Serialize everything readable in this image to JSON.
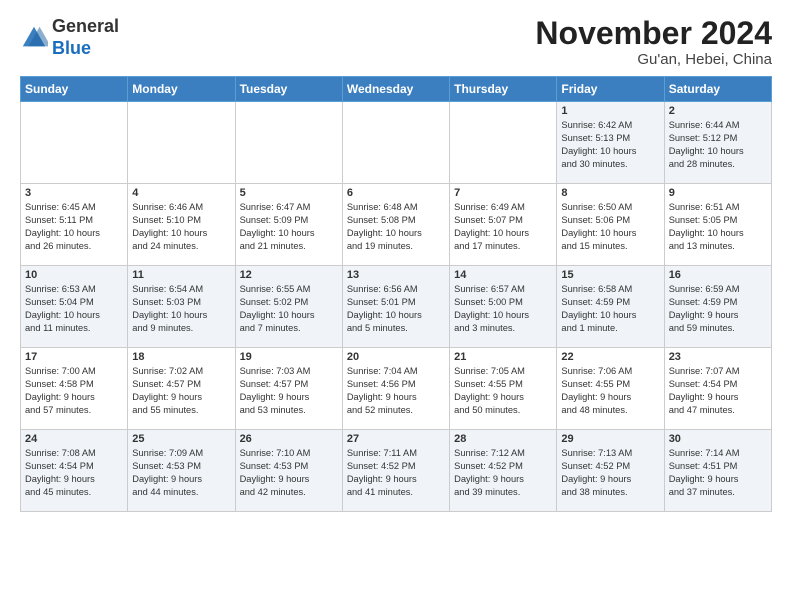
{
  "header": {
    "logo_general": "General",
    "logo_blue": "Blue",
    "month_title": "November 2024",
    "location": "Gu'an, Hebei, China"
  },
  "calendar": {
    "days_of_week": [
      "Sunday",
      "Monday",
      "Tuesday",
      "Wednesday",
      "Thursday",
      "Friday",
      "Saturday"
    ],
    "weeks": [
      {
        "row_class": "alt-row",
        "days": [
          {
            "num": "",
            "info": ""
          },
          {
            "num": "",
            "info": ""
          },
          {
            "num": "",
            "info": ""
          },
          {
            "num": "",
            "info": ""
          },
          {
            "num": "",
            "info": ""
          },
          {
            "num": "1",
            "info": "Sunrise: 6:42 AM\nSunset: 5:13 PM\nDaylight: 10 hours\nand 30 minutes."
          },
          {
            "num": "2",
            "info": "Sunrise: 6:44 AM\nSunset: 5:12 PM\nDaylight: 10 hours\nand 28 minutes."
          }
        ]
      },
      {
        "row_class": "white-row",
        "days": [
          {
            "num": "3",
            "info": "Sunrise: 6:45 AM\nSunset: 5:11 PM\nDaylight: 10 hours\nand 26 minutes."
          },
          {
            "num": "4",
            "info": "Sunrise: 6:46 AM\nSunset: 5:10 PM\nDaylight: 10 hours\nand 24 minutes."
          },
          {
            "num": "5",
            "info": "Sunrise: 6:47 AM\nSunset: 5:09 PM\nDaylight: 10 hours\nand 21 minutes."
          },
          {
            "num": "6",
            "info": "Sunrise: 6:48 AM\nSunset: 5:08 PM\nDaylight: 10 hours\nand 19 minutes."
          },
          {
            "num": "7",
            "info": "Sunrise: 6:49 AM\nSunset: 5:07 PM\nDaylight: 10 hours\nand 17 minutes."
          },
          {
            "num": "8",
            "info": "Sunrise: 6:50 AM\nSunset: 5:06 PM\nDaylight: 10 hours\nand 15 minutes."
          },
          {
            "num": "9",
            "info": "Sunrise: 6:51 AM\nSunset: 5:05 PM\nDaylight: 10 hours\nand 13 minutes."
          }
        ]
      },
      {
        "row_class": "alt-row",
        "days": [
          {
            "num": "10",
            "info": "Sunrise: 6:53 AM\nSunset: 5:04 PM\nDaylight: 10 hours\nand 11 minutes."
          },
          {
            "num": "11",
            "info": "Sunrise: 6:54 AM\nSunset: 5:03 PM\nDaylight: 10 hours\nand 9 minutes."
          },
          {
            "num": "12",
            "info": "Sunrise: 6:55 AM\nSunset: 5:02 PM\nDaylight: 10 hours\nand 7 minutes."
          },
          {
            "num": "13",
            "info": "Sunrise: 6:56 AM\nSunset: 5:01 PM\nDaylight: 10 hours\nand 5 minutes."
          },
          {
            "num": "14",
            "info": "Sunrise: 6:57 AM\nSunset: 5:00 PM\nDaylight: 10 hours\nand 3 minutes."
          },
          {
            "num": "15",
            "info": "Sunrise: 6:58 AM\nSunset: 4:59 PM\nDaylight: 10 hours\nand 1 minute."
          },
          {
            "num": "16",
            "info": "Sunrise: 6:59 AM\nSunset: 4:59 PM\nDaylight: 9 hours\nand 59 minutes."
          }
        ]
      },
      {
        "row_class": "white-row",
        "days": [
          {
            "num": "17",
            "info": "Sunrise: 7:00 AM\nSunset: 4:58 PM\nDaylight: 9 hours\nand 57 minutes."
          },
          {
            "num": "18",
            "info": "Sunrise: 7:02 AM\nSunset: 4:57 PM\nDaylight: 9 hours\nand 55 minutes."
          },
          {
            "num": "19",
            "info": "Sunrise: 7:03 AM\nSunset: 4:57 PM\nDaylight: 9 hours\nand 53 minutes."
          },
          {
            "num": "20",
            "info": "Sunrise: 7:04 AM\nSunset: 4:56 PM\nDaylight: 9 hours\nand 52 minutes."
          },
          {
            "num": "21",
            "info": "Sunrise: 7:05 AM\nSunset: 4:55 PM\nDaylight: 9 hours\nand 50 minutes."
          },
          {
            "num": "22",
            "info": "Sunrise: 7:06 AM\nSunset: 4:55 PM\nDaylight: 9 hours\nand 48 minutes."
          },
          {
            "num": "23",
            "info": "Sunrise: 7:07 AM\nSunset: 4:54 PM\nDaylight: 9 hours\nand 47 minutes."
          }
        ]
      },
      {
        "row_class": "alt-row",
        "days": [
          {
            "num": "24",
            "info": "Sunrise: 7:08 AM\nSunset: 4:54 PM\nDaylight: 9 hours\nand 45 minutes."
          },
          {
            "num": "25",
            "info": "Sunrise: 7:09 AM\nSunset: 4:53 PM\nDaylight: 9 hours\nand 44 minutes."
          },
          {
            "num": "26",
            "info": "Sunrise: 7:10 AM\nSunset: 4:53 PM\nDaylight: 9 hours\nand 42 minutes."
          },
          {
            "num": "27",
            "info": "Sunrise: 7:11 AM\nSunset: 4:52 PM\nDaylight: 9 hours\nand 41 minutes."
          },
          {
            "num": "28",
            "info": "Sunrise: 7:12 AM\nSunset: 4:52 PM\nDaylight: 9 hours\nand 39 minutes."
          },
          {
            "num": "29",
            "info": "Sunrise: 7:13 AM\nSunset: 4:52 PM\nDaylight: 9 hours\nand 38 minutes."
          },
          {
            "num": "30",
            "info": "Sunrise: 7:14 AM\nSunset: 4:51 PM\nDaylight: 9 hours\nand 37 minutes."
          }
        ]
      }
    ]
  }
}
